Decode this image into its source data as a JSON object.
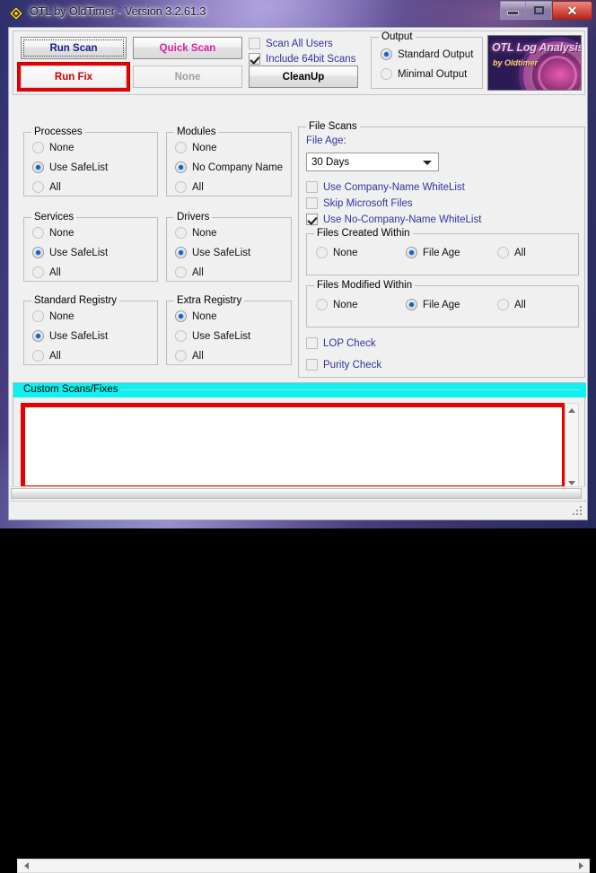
{
  "window": {
    "title": "OTL by OldTimer - Version 3.2.61.3",
    "app_icon": "otl-diamond-icon",
    "minimize_label": "–",
    "maximize_label": "□",
    "close_label": "✕"
  },
  "toolbar": {
    "run_scan": "Run Scan",
    "run_fix": "Run Fix",
    "quick_scan": "Quick Scan",
    "none_button": "None",
    "cleanup": "CleanUp",
    "scan_all_users": {
      "label": "Scan All Users",
      "checked": false
    },
    "include_64bit": {
      "label": "Include 64bit Scans",
      "checked": true
    }
  },
  "output": {
    "legend": "Output",
    "options": [
      {
        "label": "Standard Output",
        "selected": true
      },
      {
        "label": "Minimal Output",
        "selected": false
      }
    ]
  },
  "logo": {
    "line1": "OTL Log Analysis",
    "line2": "by Oldtimer"
  },
  "groups": {
    "processes": {
      "legend": "Processes",
      "options": [
        {
          "label": "None",
          "selected": false
        },
        {
          "label": "Use SafeList",
          "selected": true
        },
        {
          "label": "All",
          "selected": false
        }
      ]
    },
    "modules": {
      "legend": "Modules",
      "options": [
        {
          "label": "None",
          "selected": false
        },
        {
          "label": "No Company Name",
          "selected": true
        },
        {
          "label": "All",
          "selected": false
        }
      ]
    },
    "services": {
      "legend": "Services",
      "options": [
        {
          "label": "None",
          "selected": false
        },
        {
          "label": "Use SafeList",
          "selected": true
        },
        {
          "label": "All",
          "selected": false
        }
      ]
    },
    "drivers": {
      "legend": "Drivers",
      "options": [
        {
          "label": "None",
          "selected": false
        },
        {
          "label": "Use SafeList",
          "selected": true
        },
        {
          "label": "All",
          "selected": false
        }
      ]
    },
    "standard_registry": {
      "legend": "Standard Registry",
      "options": [
        {
          "label": "None",
          "selected": false
        },
        {
          "label": "Use SafeList",
          "selected": true
        },
        {
          "label": "All",
          "selected": false
        }
      ]
    },
    "extra_registry": {
      "legend": "Extra Registry",
      "options": [
        {
          "label": "None",
          "selected": true
        },
        {
          "label": "Use SafeList",
          "selected": false
        },
        {
          "label": "All",
          "selected": false
        }
      ]
    }
  },
  "file_scans": {
    "legend": "File Scans",
    "file_age_label": "File Age:",
    "file_age_value": "30 Days",
    "file_age_options": [
      "30 Days"
    ],
    "checkboxes": [
      {
        "label": "Use Company-Name WhiteList",
        "checked": false
      },
      {
        "label": "Skip Microsoft Files",
        "checked": false
      },
      {
        "label": "Use No-Company-Name WhiteList",
        "checked": true
      }
    ],
    "files_created_within": {
      "legend": "Files Created Within",
      "options": [
        {
          "label": "None",
          "selected": false
        },
        {
          "label": "File Age",
          "selected": true
        },
        {
          "label": "All",
          "selected": false
        }
      ]
    },
    "files_modified_within": {
      "legend": "Files Modified Within",
      "options": [
        {
          "label": "None",
          "selected": false
        },
        {
          "label": "File Age",
          "selected": true
        },
        {
          "label": "All",
          "selected": false
        }
      ]
    },
    "extra_checks": [
      {
        "label": "LOP Check",
        "checked": false
      },
      {
        "label": "Purity Check",
        "checked": false
      }
    ]
  },
  "custom_scans": {
    "legend": "Custom Scans/Fixes",
    "text_value": "",
    "scroll_up_icon": "triangle-up-icon",
    "scroll_down_icon": "triangle-down-icon",
    "scroll_left_icon": "triangle-left-icon",
    "scroll_right_icon": "triangle-right-icon"
  },
  "colors": {
    "highlight_red": "#e80000",
    "cyan_bar": "#0ff0f0",
    "link_blue": "#3333a0",
    "run_scan_blue": "#1a1a8c",
    "quick_scan_pink": "#e020a0",
    "radio_dot_blue": "#1565c0"
  }
}
